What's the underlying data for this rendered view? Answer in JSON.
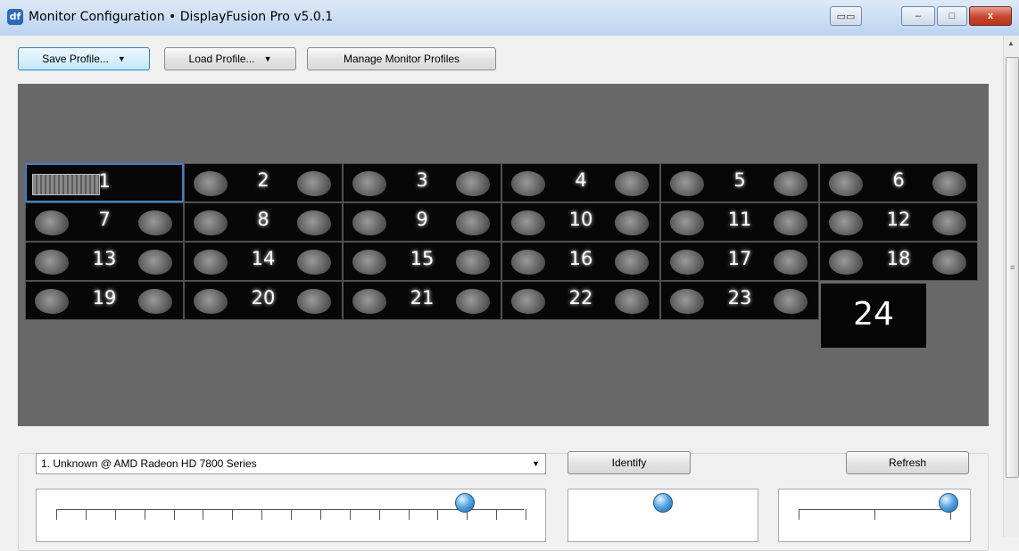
{
  "window": {
    "title": "Monitor Configuration • DisplayFusion Pro v5.0.1",
    "app_icon": "displayfusion-icon",
    "controls": {
      "extra": "▭▭",
      "minimize": "–",
      "maximize": "□",
      "close": "x"
    }
  },
  "toolbar": {
    "save_profile": "Save Profile...",
    "load_profile": "Load Profile...",
    "manage_profiles": "Manage Monitor Profiles"
  },
  "monitors": [
    {
      "number": "1"
    },
    {
      "number": "2"
    },
    {
      "number": "3"
    },
    {
      "number": "4"
    },
    {
      "number": "5"
    },
    {
      "number": "6"
    },
    {
      "number": "7"
    },
    {
      "number": "8"
    },
    {
      "number": "9"
    },
    {
      "number": "10"
    },
    {
      "number": "11"
    },
    {
      "number": "12"
    },
    {
      "number": "13"
    },
    {
      "number": "14"
    },
    {
      "number": "15"
    },
    {
      "number": "16"
    },
    {
      "number": "17"
    },
    {
      "number": "18"
    },
    {
      "number": "19"
    },
    {
      "number": "20"
    },
    {
      "number": "21"
    },
    {
      "number": "22"
    },
    {
      "number": "23"
    },
    {
      "number": "24"
    }
  ],
  "selected_monitor_index": 0,
  "details": {
    "monitor_select": "1. Unknown @ AMD Radeon HD 7800 Series",
    "identify": "Identify",
    "refresh": "Refresh"
  },
  "sliders": {
    "resolution_level": 0.87,
    "middle_level": 0.5,
    "right_level": 1.0
  },
  "colors": {
    "accent": "#3e7fc8",
    "canvas": "#686868",
    "knob": "#58a8e6"
  }
}
